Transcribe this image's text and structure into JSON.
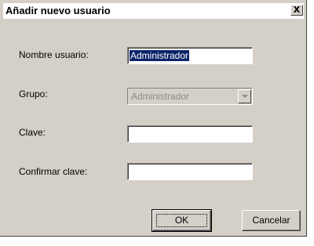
{
  "window": {
    "title": "Añadir nuevo usuario",
    "close_glyph": "X"
  },
  "form": {
    "username": {
      "label": "Nombre usuario:",
      "value": "Administrador"
    },
    "group": {
      "label": "Grupo:",
      "selected": "Administrador",
      "disabled": true
    },
    "password": {
      "label": "Clave:",
      "value": ""
    },
    "confirm": {
      "label": "Confirmar clave:",
      "value": ""
    }
  },
  "buttons": {
    "ok": "OK",
    "cancel": "Cancelar"
  },
  "colors": {
    "face": "#d4d0c8",
    "selection": "#0a246a",
    "disabled_text": "#8a8a8a"
  }
}
